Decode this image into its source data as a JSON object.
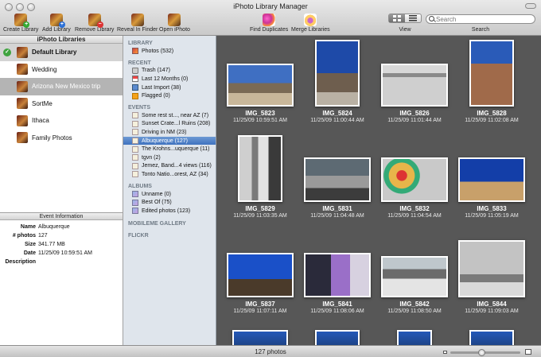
{
  "window": {
    "title": "iPhoto Library Manager"
  },
  "toolbar": {
    "create_library": "Create Library",
    "add_library": "Add Library",
    "remove_library": "Remove Library",
    "reveal_in_finder": "Reveal In Finder",
    "open_iphoto": "Open iPhoto",
    "find_duplicates": "Find Duplicates",
    "merge_libraries": "Merge Libraries",
    "view_label": "View",
    "search_label": "Search",
    "search_placeholder": "Search"
  },
  "libraries": {
    "header": "iPhoto Libraries",
    "items": [
      {
        "label": "Default Library",
        "state": "current"
      },
      {
        "label": "Wedding",
        "state": ""
      },
      {
        "label": "Arizona New Mexico trip",
        "state": "dimmed"
      },
      {
        "label": "SortMe",
        "state": ""
      },
      {
        "label": "Ithaca",
        "state": ""
      },
      {
        "label": "Family Photos",
        "state": ""
      }
    ]
  },
  "event_info": {
    "header": "Event Information",
    "name_key": "Name",
    "name": "Albuquerque",
    "photos_key": "# photos",
    "photos": "127",
    "size_key": "Size",
    "size": "341.77 MB",
    "date_key": "Date",
    "date": "11/25/09 10:59:51 AM",
    "description_key": "Description",
    "description": ""
  },
  "source_list": {
    "library_header": "LIBRARY",
    "photos": "Photos (532)",
    "recent_header": "RECENT",
    "trash": "Trash (147)",
    "last_12_months": "Last 12 Months (0)",
    "last_import": "Last Import (38)",
    "flagged": "Flagged (0)",
    "events_header": "EVENTS",
    "events": [
      "Some rest st..., near AZ (7)",
      "Sunset Crate...l Ruins (208)",
      "Driving in NM (23)",
      "Albuquerque (127)",
      "The Krohns...uquerque (11)",
      "tgvn (2)",
      "Jemez, Band...4 views (116)",
      "Tonto Natio...orest, AZ (34)"
    ],
    "albums_header": "ALBUMS",
    "albums": [
      "Unname (0)",
      "Best Of (75)",
      "Edited photos (123)"
    ],
    "mobileme_header": "MOBILEME GALLERY",
    "flickr_header": "FLICKR"
  },
  "photos": [
    {
      "title": "IMG_5823",
      "date": "11/25/09 10:59:51 AM"
    },
    {
      "title": "IMG_5824",
      "date": "11/25/09 11:00:44 AM"
    },
    {
      "title": "IMG_5826",
      "date": "11/25/09 11:01:44 AM"
    },
    {
      "title": "IMG_5828",
      "date": "11/25/09 11:02:08 AM"
    },
    {
      "title": "IMG_5829",
      "date": "11/25/09 11:03:35 AM"
    },
    {
      "title": "IMG_5831",
      "date": "11/25/09 11:04:48 AM"
    },
    {
      "title": "IMG_5832",
      "date": "11/25/09 11:04:54 AM"
    },
    {
      "title": "IMG_5833",
      "date": "11/25/09 11:05:19 AM"
    },
    {
      "title": "IMG_5837",
      "date": "11/25/09 11:07:11 AM"
    },
    {
      "title": "IMG_5841",
      "date": "11/25/09 11:08:06 AM"
    },
    {
      "title": "IMG_5842",
      "date": "11/25/09 11:08:50 AM"
    },
    {
      "title": "IMG_5844",
      "date": "11/25/09 11:09:03 AM"
    }
  ],
  "status": {
    "count": "127 photos",
    "zoom_fraction": 0.45
  }
}
